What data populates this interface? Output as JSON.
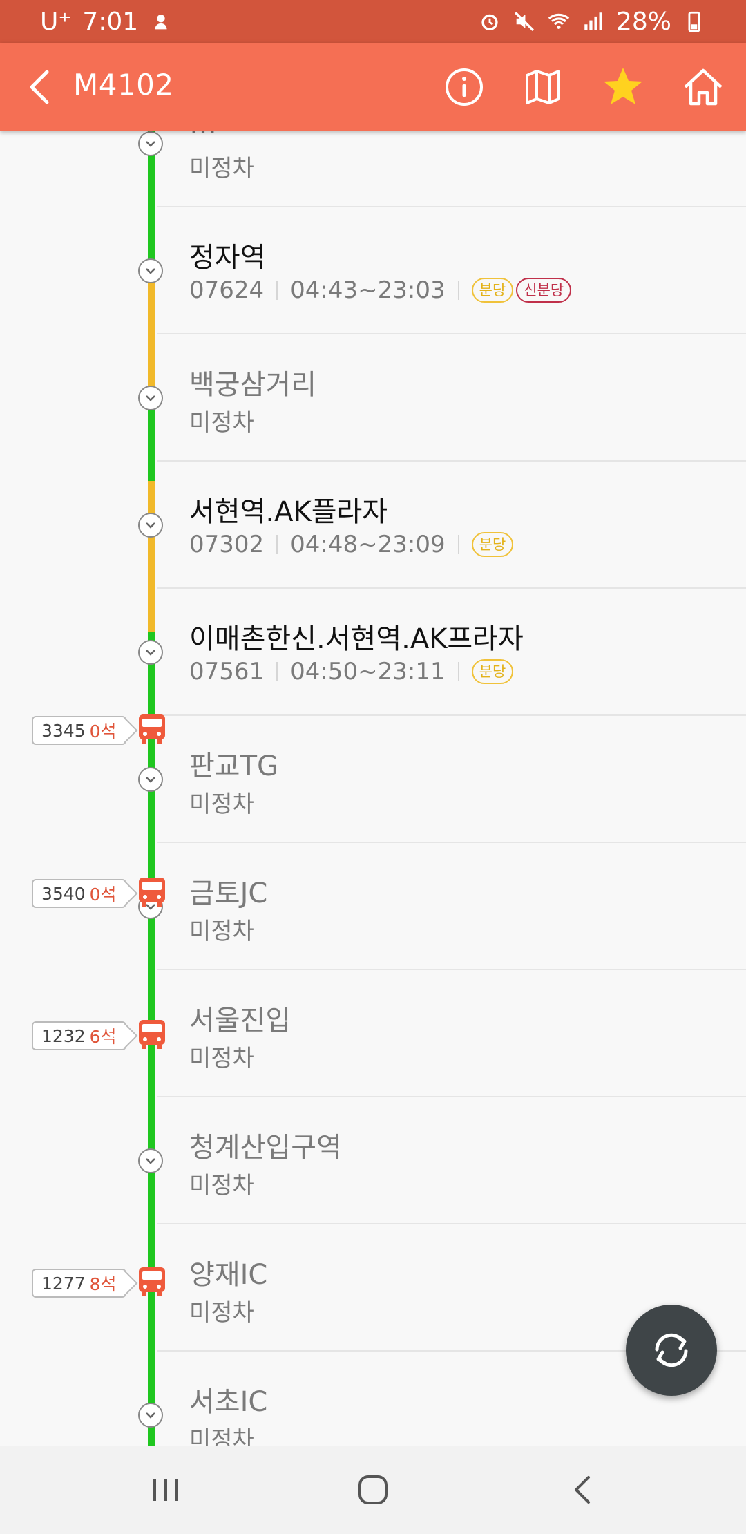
{
  "status_bar": {
    "carrier": "U⁺",
    "time": "7:01",
    "battery": "28%"
  },
  "header": {
    "title": "M4102",
    "icons": [
      "back-icon",
      "info-icon",
      "map-icon",
      "star-icon",
      "home-icon"
    ]
  },
  "stops": [
    {
      "name": "…",
      "status": "미정차",
      "dim": true
    },
    {
      "name": "정자역",
      "code": "07624",
      "hours": "04:43~23:03",
      "badges": [
        {
          "text": "분당",
          "color": "yellow"
        },
        {
          "text": "신분당",
          "color": "red"
        }
      ]
    },
    {
      "name": "백궁삼거리",
      "status": "미정차",
      "dim": true
    },
    {
      "name": "서현역.AK플라자",
      "code": "07302",
      "hours": "04:48~23:09",
      "badges": [
        {
          "text": "분당",
          "color": "yellow"
        }
      ]
    },
    {
      "name": "이매촌한신.서현역.AK프라자",
      "code": "07561",
      "hours": "04:50~23:11",
      "badges": [
        {
          "text": "분당",
          "color": "yellow"
        }
      ]
    },
    {
      "name": "판교TG",
      "status": "미정차",
      "dim": true
    },
    {
      "name": "금토JC",
      "status": "미정차",
      "dim": true
    },
    {
      "name": "서울진입",
      "status": "미정차",
      "dim": true
    },
    {
      "name": "청계산입구역",
      "status": "미정차",
      "dim": true
    },
    {
      "name": "양재IC",
      "status": "미정차",
      "dim": true
    },
    {
      "name": "서초IC",
      "status": "미정차",
      "dim": true
    }
  ],
  "buses": [
    {
      "number": "3345",
      "seats": "0석"
    },
    {
      "number": "3540",
      "seats": "0석"
    },
    {
      "number": "1232",
      "seats": "6석"
    },
    {
      "number": "1277",
      "seats": "8석"
    }
  ],
  "colors": {
    "accent": "#f56f54",
    "status_bar": "#d2553c",
    "line_green": "#1fc71f",
    "line_yellow": "#f1b92a",
    "bus_red": "#ef5a3c"
  },
  "fab": {
    "icon": "refresh-icon"
  },
  "nav": {
    "icons": [
      "recent-apps-icon",
      "home-circle-icon",
      "back-nav-icon"
    ]
  }
}
